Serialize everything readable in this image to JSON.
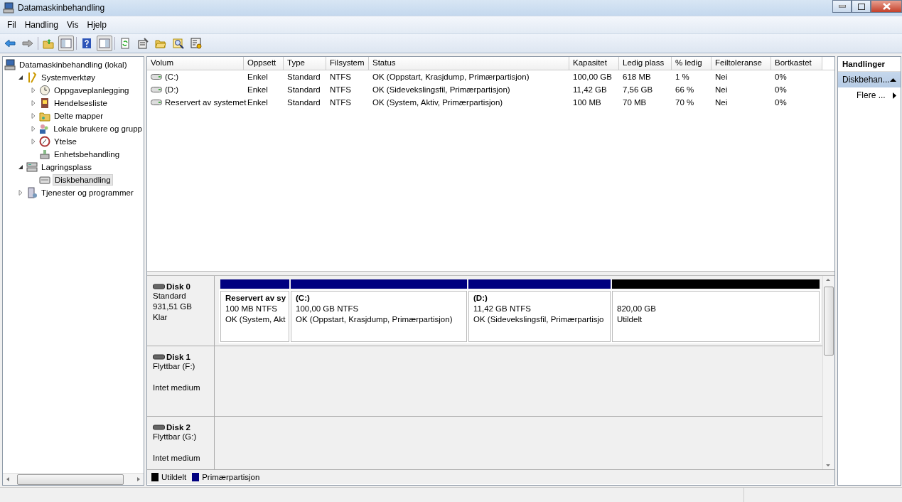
{
  "window": {
    "title": "Datamaskinbehandling"
  },
  "menu": [
    "Fil",
    "Handling",
    "Vis",
    "Hjelp"
  ],
  "tree": [
    {
      "label": "Datamaskinbehandling (lokal)",
      "selected": false,
      "children": [
        {
          "label": "Systemverktøy",
          "expanded": true,
          "selected": false,
          "children": [
            {
              "label": "Oppgaveplanlegging",
              "expanded": false,
              "selected": false
            },
            {
              "label": "Hendelsesliste",
              "expanded": false,
              "selected": false
            },
            {
              "label": "Delte mapper",
              "expanded": false,
              "selected": false
            },
            {
              "label": "Lokale brukere og grupp",
              "expanded": false,
              "selected": false
            },
            {
              "label": "Ytelse",
              "expanded": false,
              "selected": false
            },
            {
              "label": "Enhetsbehandling",
              "selected": false
            }
          ]
        },
        {
          "label": "Lagringsplass",
          "expanded": true,
          "selected": false,
          "children": [
            {
              "label": "Diskbehandling",
              "selected": true
            }
          ]
        },
        {
          "label": "Tjenester og programmer",
          "expanded": false,
          "selected": false
        }
      ]
    }
  ],
  "table": {
    "columns": [
      "Volum",
      "Oppsett",
      "Type",
      "Filsystem",
      "Status",
      "Kapasitet",
      "Ledig plass",
      "% ledig",
      "Feiltoleranse",
      "Bortkastet"
    ],
    "rows": [
      [
        "(C:)",
        "Enkel",
        "Standard",
        "NTFS",
        "OK (Oppstart, Krasjdump, Primærpartisjon)",
        "100,00 GB",
        "618 MB",
        "1 %",
        "Nei",
        "0%"
      ],
      [
        "(D:)",
        "Enkel",
        "Standard",
        "NTFS",
        "OK (Sidevekslingsfil, Primærpartisjon)",
        "11,42 GB",
        "7,56 GB",
        "66 %",
        "Nei",
        "0%"
      ],
      [
        "Reservert av systemet",
        "Enkel",
        "Standard",
        "NTFS",
        "OK (System, Aktiv, Primærpartisjon)",
        "100 MB",
        "70 MB",
        "70 %",
        "Nei",
        "0%"
      ]
    ]
  },
  "disks": [
    {
      "name": "Disk 0",
      "type": "Standard",
      "size": "931,51 GB",
      "status": "Klar",
      "partitions": [
        {
          "kind": "primary",
          "title": "Reservert av sy",
          "size": "100 MB NTFS",
          "status": "OK (System, Akt"
        },
        {
          "kind": "primary",
          "title": "(C:)",
          "size": "100,00 GB NTFS",
          "status": "OK (Oppstart, Krasjdump, Primærpartisjon)"
        },
        {
          "kind": "primary",
          "title": "(D:)",
          "size": "11,42 GB NTFS",
          "status": "OK (Sidevekslingsfil, Primærpartisjo"
        },
        {
          "kind": "unallocated",
          "size": "820,00 GB",
          "status": "Utildelt"
        }
      ]
    },
    {
      "name": "Disk 1",
      "type": "Flyttbar (F:)",
      "status": "Intet medium"
    },
    {
      "name": "Disk 2",
      "type": "Flyttbar (G:)",
      "status": "Intet medium"
    }
  ],
  "legend": [
    {
      "label": "Utildelt",
      "color": "#000000"
    },
    {
      "label": "Primærpartisjon",
      "color": "#000080"
    }
  ],
  "actions": {
    "title": "Handlinger",
    "section": {
      "label": "Diskbehan...",
      "expanded": true
    },
    "items": [
      "Flere ..."
    ]
  }
}
